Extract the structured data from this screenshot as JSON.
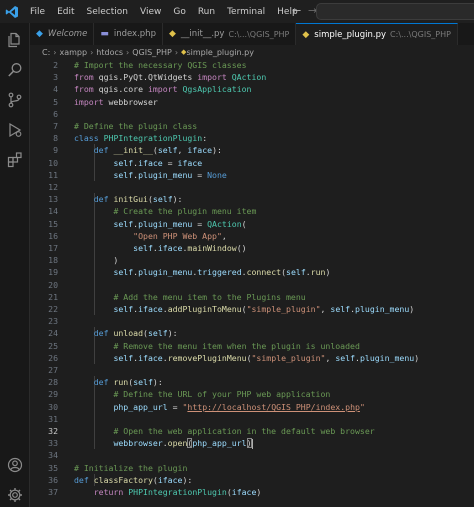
{
  "menu": [
    "File",
    "Edit",
    "Selection",
    "View",
    "Go",
    "Run",
    "Terminal",
    "Help"
  ],
  "nav": {
    "back": "←",
    "forward": "→"
  },
  "tabs": [
    {
      "icon": "vscode-icon",
      "label": "Welcome",
      "desc": "",
      "active": false,
      "italic": true
    },
    {
      "icon": "php-file-icon",
      "label": "index.php",
      "desc": "",
      "active": false,
      "italic": false
    },
    {
      "icon": "python-file-icon",
      "label": "__init__.py",
      "desc": "C:\\...\\QGIS_PHP",
      "active": false,
      "italic": false
    },
    {
      "icon": "python-file-icon",
      "label": "simple_plugin.py",
      "desc": "C:\\...\\QGIS_PHP",
      "active": true,
      "italic": false
    }
  ],
  "breadcrumb": [
    "C:",
    "xampp",
    "htdocs",
    "QGIS_PHP",
    "simple_plugin.py"
  ],
  "activity_icons": [
    "files-icon",
    "search-icon",
    "source-control-icon",
    "run-debug-icon",
    "extensions-icon"
  ],
  "activity_bottom_icons": [
    "account-icon",
    "settings-gear-icon"
  ],
  "editor": {
    "first_line": 2,
    "current_line": 32,
    "lines": [
      [
        [
          "c",
          "# Import the necessary QGIS classes"
        ]
      ],
      [
        [
          "k",
          "from"
        ],
        [
          "p",
          " qgis.PyQt.QtWidgets "
        ],
        [
          "k",
          "import"
        ],
        [
          "p",
          " "
        ],
        [
          "cl",
          "QAction"
        ]
      ],
      [
        [
          "k",
          "from"
        ],
        [
          "p",
          " qgis.core "
        ],
        [
          "k",
          "import"
        ],
        [
          "p",
          " "
        ],
        [
          "cl",
          "QgsApplication"
        ]
      ],
      [
        [
          "k",
          "import"
        ],
        [
          "p",
          " webbrowser"
        ]
      ],
      [],
      [
        [
          "c",
          "# Define the plugin class"
        ]
      ],
      [
        [
          "kb",
          "class"
        ],
        [
          "p",
          " "
        ],
        [
          "cl",
          "PHPIntegrationPlugin"
        ],
        [
          "p",
          ":"
        ]
      ],
      [
        [
          "p",
          "    "
        ],
        [
          "kb",
          "def"
        ],
        [
          "p",
          " "
        ],
        [
          "f",
          "__init__"
        ],
        [
          "p",
          "("
        ],
        [
          "v",
          "self"
        ],
        [
          "p",
          ", "
        ],
        [
          "v",
          "iface"
        ],
        [
          "p",
          "):"
        ]
      ],
      [
        [
          "p",
          "        "
        ],
        [
          "v",
          "self"
        ],
        [
          "p",
          "."
        ],
        [
          "v",
          "iface"
        ],
        [
          "p",
          " = "
        ],
        [
          "v",
          "iface"
        ]
      ],
      [
        [
          "p",
          "        "
        ],
        [
          "v",
          "self"
        ],
        [
          "p",
          "."
        ],
        [
          "v",
          "plugin_menu"
        ],
        [
          "p",
          " = "
        ],
        [
          "kb",
          "None"
        ]
      ],
      [],
      [
        [
          "p",
          "    "
        ],
        [
          "kb",
          "def"
        ],
        [
          "p",
          " "
        ],
        [
          "f",
          "initGui"
        ],
        [
          "p",
          "("
        ],
        [
          "v",
          "self"
        ],
        [
          "p",
          "):"
        ]
      ],
      [
        [
          "p",
          "        "
        ],
        [
          "c",
          "# Create the plugin menu item"
        ]
      ],
      [
        [
          "p",
          "        "
        ],
        [
          "v",
          "self"
        ],
        [
          "p",
          "."
        ],
        [
          "v",
          "plugin_menu"
        ],
        [
          "p",
          " = "
        ],
        [
          "cl",
          "QAction"
        ],
        [
          "p",
          "("
        ]
      ],
      [
        [
          "p",
          "            "
        ],
        [
          "s",
          "\"Open PHP Web App\""
        ],
        [
          "p",
          ","
        ]
      ],
      [
        [
          "p",
          "            "
        ],
        [
          "v",
          "self"
        ],
        [
          "p",
          "."
        ],
        [
          "v",
          "iface"
        ],
        [
          "p",
          "."
        ],
        [
          "f",
          "mainWindow"
        ],
        [
          "p",
          "()"
        ]
      ],
      [
        [
          "p",
          "        )"
        ]
      ],
      [
        [
          "p",
          "        "
        ],
        [
          "v",
          "self"
        ],
        [
          "p",
          "."
        ],
        [
          "v",
          "plugin_menu"
        ],
        [
          "p",
          "."
        ],
        [
          "v",
          "triggered"
        ],
        [
          "p",
          "."
        ],
        [
          "f",
          "connect"
        ],
        [
          "p",
          "("
        ],
        [
          "v",
          "self"
        ],
        [
          "p",
          "."
        ],
        [
          "f",
          "run"
        ],
        [
          "p",
          ")"
        ]
      ],
      [],
      [
        [
          "p",
          "        "
        ],
        [
          "c",
          "# Add the menu item to the Plugins menu"
        ]
      ],
      [
        [
          "p",
          "        "
        ],
        [
          "v",
          "self"
        ],
        [
          "p",
          "."
        ],
        [
          "v",
          "iface"
        ],
        [
          "p",
          "."
        ],
        [
          "f",
          "addPluginToMenu"
        ],
        [
          "p",
          "("
        ],
        [
          "s",
          "\"simple_plugin\""
        ],
        [
          "p",
          ", "
        ],
        [
          "v",
          "self"
        ],
        [
          "p",
          "."
        ],
        [
          "v",
          "plugin_menu"
        ],
        [
          "p",
          ")"
        ]
      ],
      [],
      [
        [
          "p",
          "    "
        ],
        [
          "kb",
          "def"
        ],
        [
          "p",
          " "
        ],
        [
          "f",
          "unload"
        ],
        [
          "p",
          "("
        ],
        [
          "v",
          "self"
        ],
        [
          "p",
          "):"
        ]
      ],
      [
        [
          "p",
          "        "
        ],
        [
          "c",
          "# Remove the menu item when the plugin is unloaded"
        ]
      ],
      [
        [
          "p",
          "        "
        ],
        [
          "v",
          "self"
        ],
        [
          "p",
          "."
        ],
        [
          "v",
          "iface"
        ],
        [
          "p",
          "."
        ],
        [
          "f",
          "removePluginMenu"
        ],
        [
          "p",
          "("
        ],
        [
          "s",
          "\"simple_plugin\""
        ],
        [
          "p",
          ", "
        ],
        [
          "v",
          "self"
        ],
        [
          "p",
          "."
        ],
        [
          "v",
          "plugin_menu"
        ],
        [
          "p",
          ")"
        ]
      ],
      [],
      [
        [
          "p",
          "    "
        ],
        [
          "kb",
          "def"
        ],
        [
          "p",
          " "
        ],
        [
          "f",
          "run"
        ],
        [
          "p",
          "("
        ],
        [
          "v",
          "self"
        ],
        [
          "p",
          "):"
        ]
      ],
      [
        [
          "p",
          "        "
        ],
        [
          "c",
          "# Define the URL of your PHP web application"
        ]
      ],
      [
        [
          "p",
          "        "
        ],
        [
          "v",
          "php_app_url"
        ],
        [
          "p",
          " = "
        ],
        [
          "s",
          "\""
        ],
        [
          "u",
          "http://localhost/QGIS_PHP/index.php"
        ],
        [
          "s",
          "\""
        ]
      ],
      [],
      [
        [
          "p",
          "        "
        ],
        [
          "c",
          "# Open the web application in the default web browser"
        ]
      ],
      [
        [
          "p",
          "        "
        ],
        [
          "v",
          "webbrowser"
        ],
        [
          "p",
          "."
        ],
        [
          "f",
          "open"
        ],
        [
          "b",
          "("
        ],
        [
          "v",
          "php_app_url"
        ],
        [
          "b",
          ")"
        ],
        [
          "cur",
          ""
        ]
      ],
      [],
      [
        [
          "c",
          "# Initialize the plugin"
        ]
      ],
      [
        [
          "kb",
          "def"
        ],
        [
          "p",
          " "
        ],
        [
          "f",
          "classFactory"
        ],
        [
          "p",
          "("
        ],
        [
          "v",
          "iface"
        ],
        [
          "p",
          "):"
        ]
      ],
      [
        [
          "p",
          "    "
        ],
        [
          "k",
          "return"
        ],
        [
          "p",
          " "
        ],
        [
          "cl",
          "PHPIntegrationPlugin"
        ],
        [
          "p",
          "("
        ],
        [
          "v",
          "iface"
        ],
        [
          "p",
          ")"
        ]
      ]
    ]
  }
}
